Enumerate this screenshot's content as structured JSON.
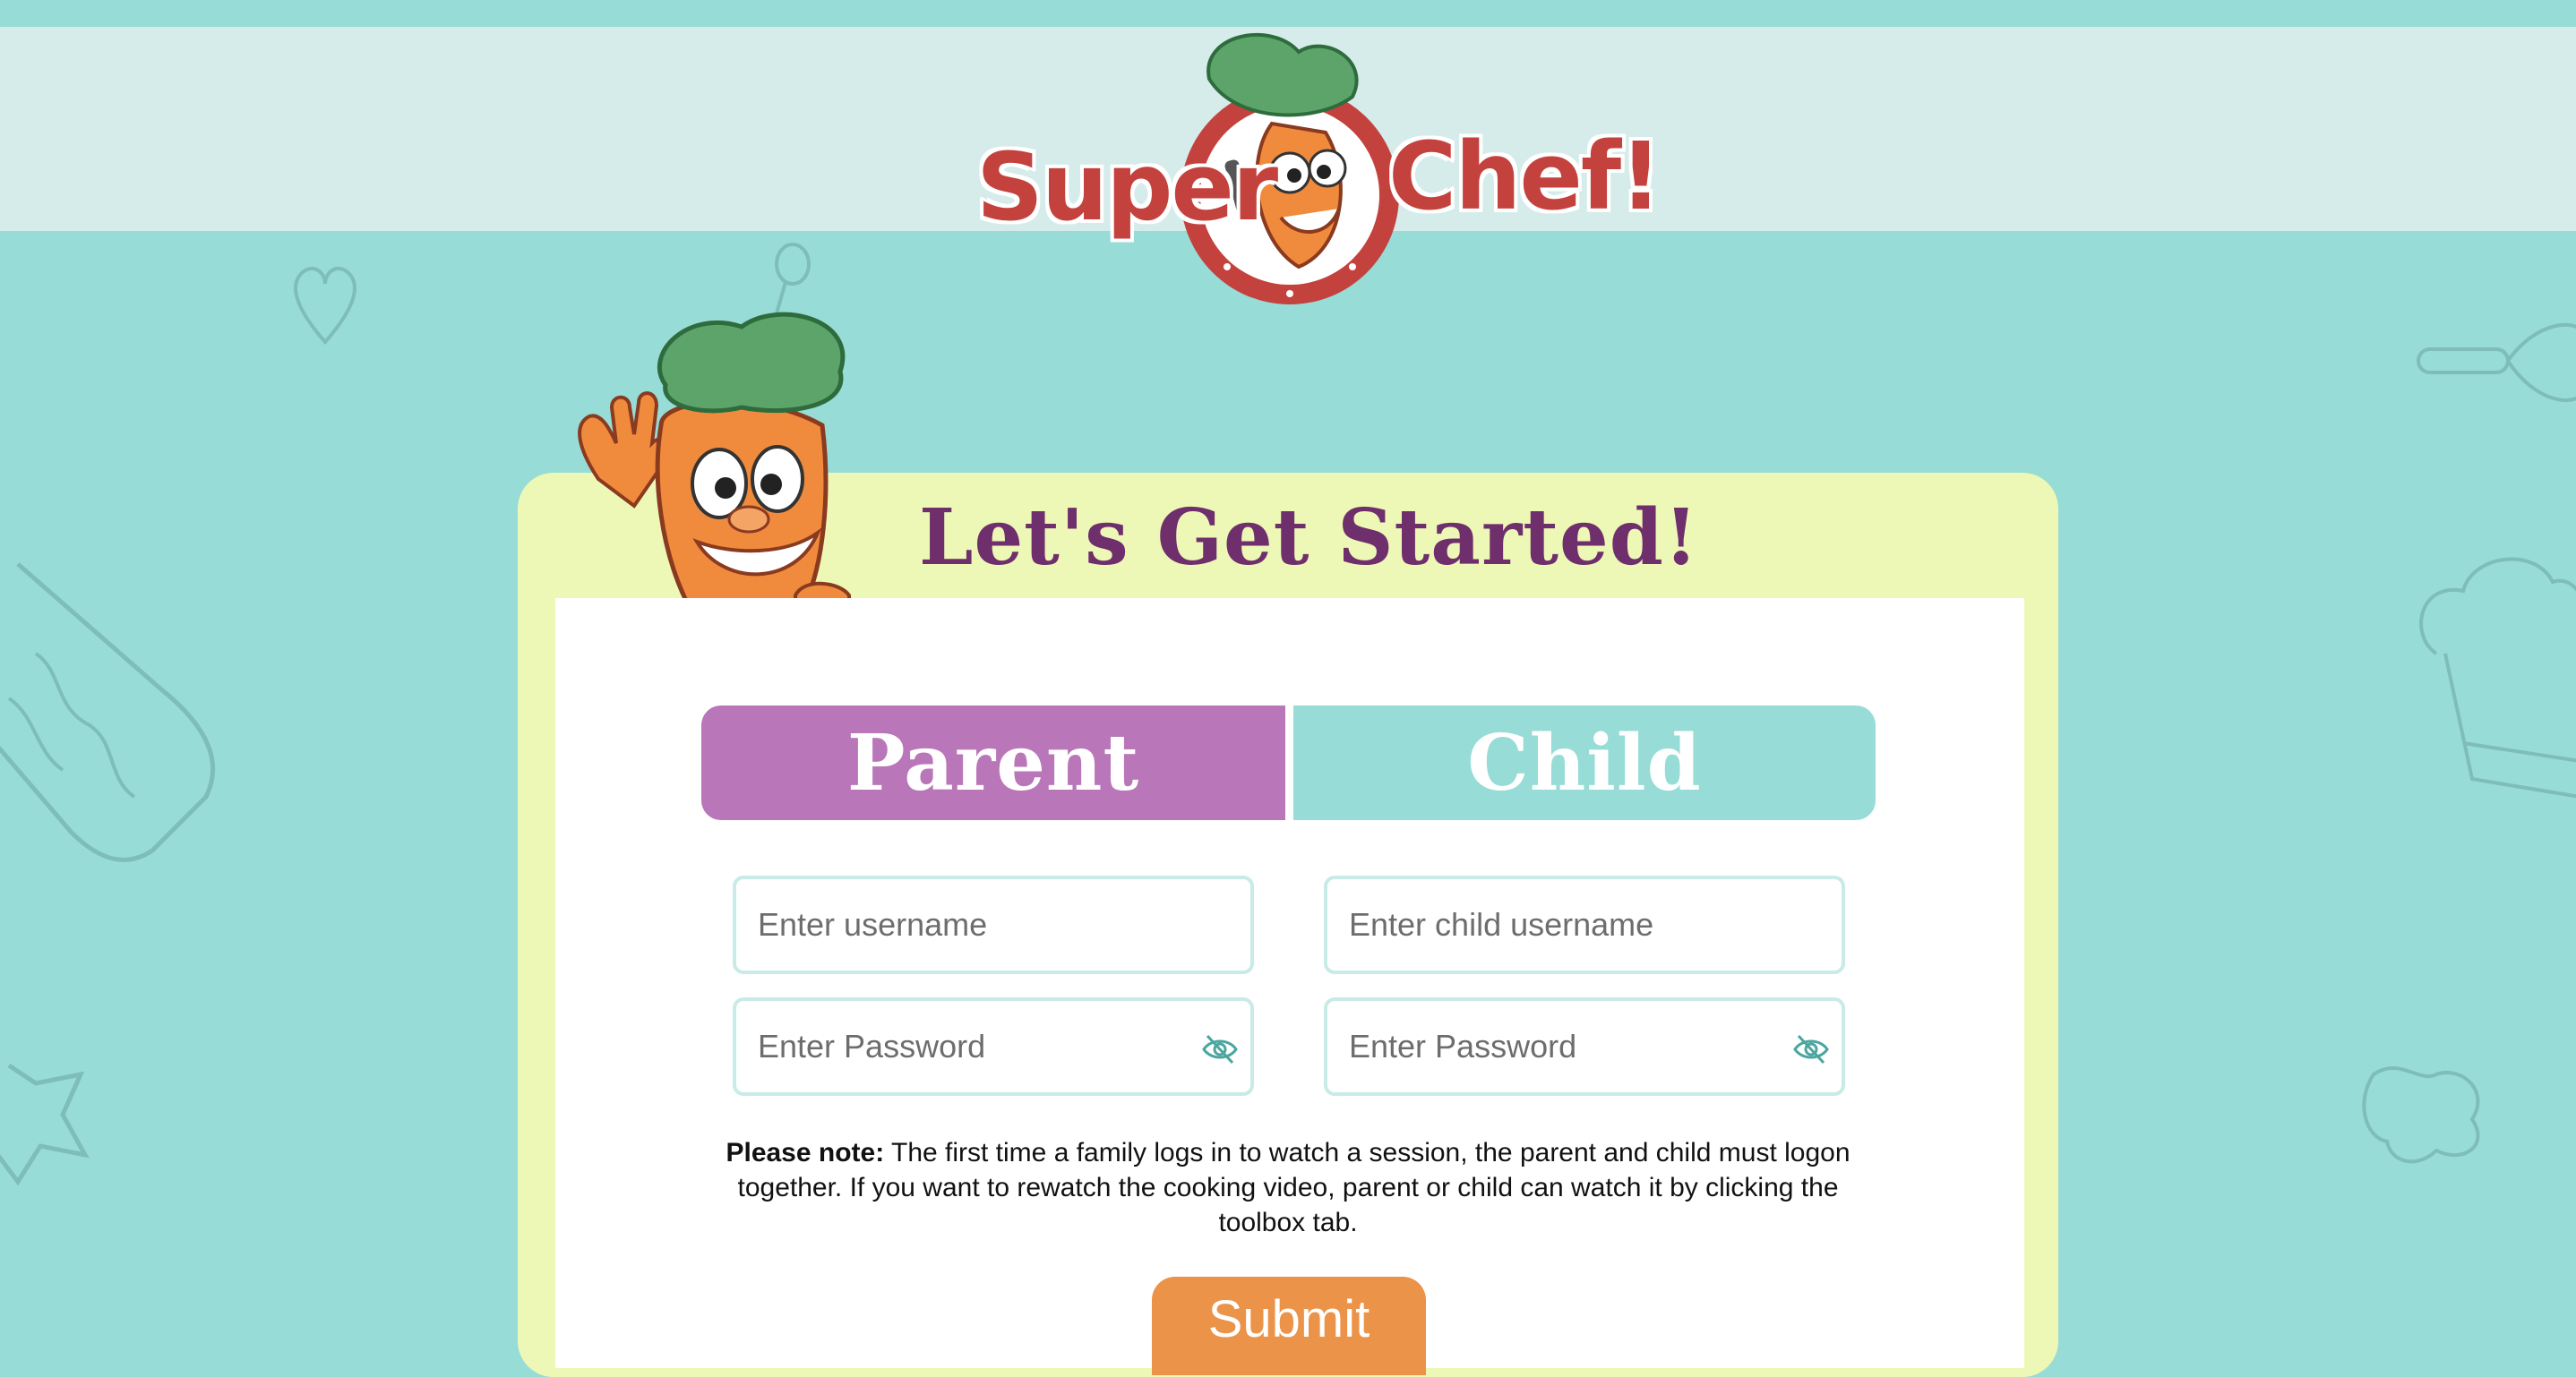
{
  "header": {
    "logo_text_left": "Super",
    "logo_text_right": "Chef!"
  },
  "card": {
    "title": "Let's Get Started!"
  },
  "tabs": [
    {
      "label": "Parent",
      "selected": true
    },
    {
      "label": "Child",
      "selected": false
    }
  ],
  "parent_form": {
    "username_placeholder": "Enter username",
    "password_placeholder": "Enter Password"
  },
  "child_form": {
    "username_placeholder": "Enter child username",
    "password_placeholder": "Enter Password"
  },
  "note": {
    "label": "Please note:",
    "text": " The first time a family logs in to watch a session, the parent and child must logon together. If you want to rewatch the cooking video, parent or child can watch it by clicking the toolbox tab."
  },
  "submit_label": "Submit",
  "colors": {
    "background": "#97dcd6",
    "header_band": "#d6ecea",
    "card": "#eef8b6",
    "title": "#6e2f6c",
    "parent_tab": "#b976b8",
    "child_tab": "#97dcd6",
    "submit": "#eb9348",
    "logo_red": "#c4423d"
  },
  "icons": {
    "password_toggle": "eye-off-icon"
  }
}
